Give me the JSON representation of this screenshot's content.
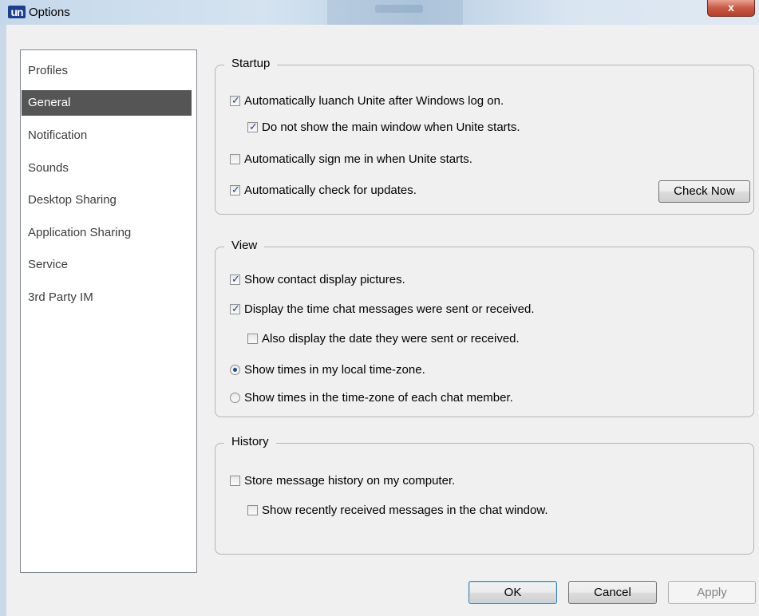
{
  "window": {
    "title": "Options",
    "logo_text": "un",
    "close_glyph": "x"
  },
  "sidebar": {
    "items": [
      {
        "label": "Profiles",
        "selected": false
      },
      {
        "label": "General",
        "selected": true
      },
      {
        "label": "Notification",
        "selected": false
      },
      {
        "label": "Sounds",
        "selected": false
      },
      {
        "label": "Desktop Sharing",
        "selected": false
      },
      {
        "label": "Application  Sharing",
        "selected": false
      },
      {
        "label": "Service",
        "selected": false
      },
      {
        "label": "3rd Party IM",
        "selected": false
      }
    ]
  },
  "startup": {
    "title": "Startup",
    "auto_launch": {
      "label": "Automatically luanch Unite after Windows log on.",
      "checked": true
    },
    "hide_main_window": {
      "label": "Do not show the main window when Unite starts.",
      "checked": true
    },
    "auto_sign_in": {
      "label": "Automatically sign me in when Unite starts.",
      "checked": false
    },
    "auto_update": {
      "label": "Automatically check for updates.",
      "checked": true
    },
    "check_now_label": "Check Now"
  },
  "view": {
    "title": "View",
    "show_pictures": {
      "label": "Show contact display pictures.",
      "checked": true
    },
    "show_time": {
      "label": "Display the time chat messages were sent or received.",
      "checked": true
    },
    "show_date": {
      "label": "Also display the date they were sent or received.",
      "checked": false
    },
    "local_tz": {
      "label": "Show times in my local time-zone.",
      "selected": true
    },
    "member_tz": {
      "label": "Show times in the time-zone of each chat member.",
      "selected": false
    }
  },
  "history": {
    "title": "History",
    "store_history": {
      "label": "Store message history on my computer.",
      "checked": false
    },
    "show_recent": {
      "label": "Show recently received messages in the chat window.",
      "checked": false
    }
  },
  "footer": {
    "ok_label": "OK",
    "cancel_label": "Cancel",
    "apply_label": "Apply"
  },
  "colors": {
    "selected_nav_bg": "#555555",
    "close_button": "#c75a44",
    "logo_bg": "#1c3f8f",
    "check_mark": "#2a3f8f"
  }
}
